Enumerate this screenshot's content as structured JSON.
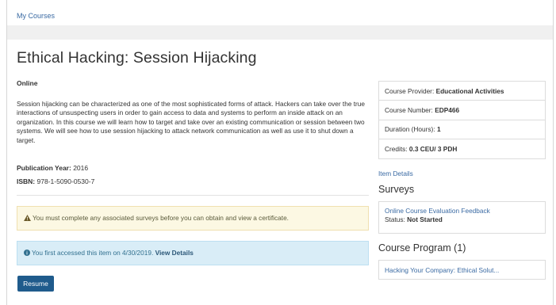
{
  "breadcrumb": "My Courses",
  "course": {
    "title": "Ethical Hacking: Session Hijacking",
    "format": "Online",
    "description": "Session hijacking can be characterized as one of the most sophisticated forms of attack. Hackers can take over the true interactions of unsuspecting users in order to gain access to data and systems to perform an inside attack on an organization. In this course we will learn how to target and take over an existing communication or session between two systems. We will see how to use session hijacking to attack network communication as well as use it to shut down a target.",
    "pub_year_label": "Publication Year:",
    "pub_year": "2016",
    "isbn_label": "ISBN:",
    "isbn": "978-1-5090-0530-7"
  },
  "alerts": {
    "warning_text": "You must complete any associated surveys before you can obtain and view a certificate.",
    "info_text": "You first accessed this item on 4/30/2019.",
    "info_link": "View Details"
  },
  "resume_label": "Resume",
  "details": {
    "provider_label": "Course Provider:",
    "provider": "Educational Activities",
    "number_label": "Course Number:",
    "number": "EDP466",
    "duration_label": "Duration (Hours):",
    "duration": "1",
    "credits_label": "Credits:",
    "credits": "0.3 CEU/ 3 PDH"
  },
  "item_details_link": "Item Details",
  "surveys": {
    "title": "Surveys",
    "item_link": "Online Course Evaluation Feedback",
    "status_label": "Status:",
    "status": "Not Started"
  },
  "course_program": {
    "title": "Course Program (1)",
    "item": "Hacking Your Company: Ethical Solut..."
  },
  "colors": {
    "link": "#3a6aa3",
    "button": "#1f5b8c",
    "warning_bg": "#fcf8e3",
    "info_bg": "#d9edf7"
  },
  "icons": {
    "warning": "warning-triangle-icon",
    "info": "info-circle-icon"
  }
}
